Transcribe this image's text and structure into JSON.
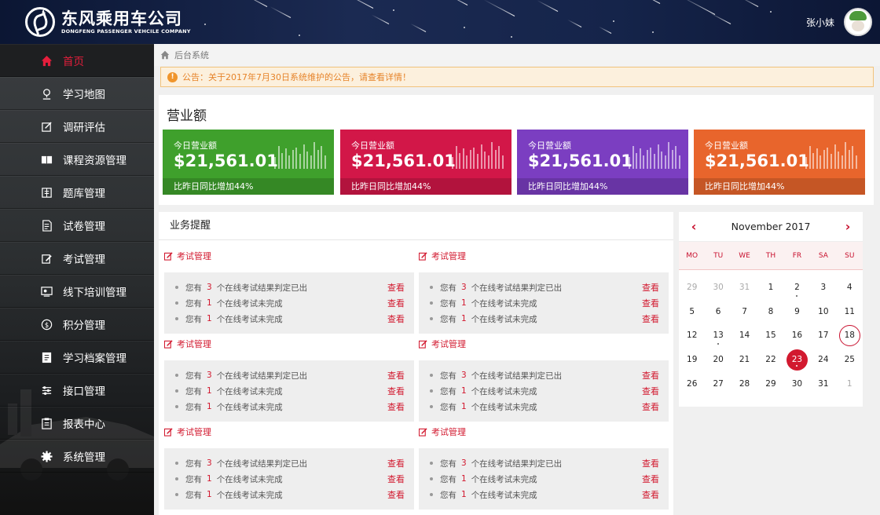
{
  "header": {
    "logo_cn": "东风乘用车公司",
    "logo_en": "DONGFENG PASSENGER VEHCILE COMPANY",
    "user_name": "张小妹"
  },
  "sidebar": {
    "items": [
      {
        "label": "首页",
        "icon": "home-icon",
        "active": true
      },
      {
        "label": "学习地图",
        "icon": "map-pin-icon"
      },
      {
        "label": "调研评估",
        "icon": "survey-edit-icon"
      },
      {
        "label": "课程资源管理",
        "icon": "book-icon"
      },
      {
        "label": "题库管理",
        "icon": "question-bank-icon"
      },
      {
        "label": "试卷管理",
        "icon": "paper-icon"
      },
      {
        "label": "考试管理",
        "icon": "exam-edit-icon"
      },
      {
        "label": "线下培训管理",
        "icon": "training-icon"
      },
      {
        "label": "积分管理",
        "icon": "coin-icon"
      },
      {
        "label": "学习档案管理",
        "icon": "archive-icon"
      },
      {
        "label": "接口管理",
        "icon": "sliders-icon"
      },
      {
        "label": "报表中心",
        "icon": "clipboard-icon"
      },
      {
        "label": "系统管理",
        "icon": "gear-icon"
      }
    ]
  },
  "breadcrumb": "后台系统",
  "notice": "公告：关于2017年7月30日系统维护的公告，请查看详情！",
  "revenue": {
    "title": "营业额",
    "cards": [
      {
        "label": "今日营业额",
        "amount": "$21,561.01",
        "footer": "比昨日同比增加44%",
        "color": "#3fa02c"
      },
      {
        "label": "今日营业额",
        "amount": "$21,561.01",
        "footer": "比昨日同比增加44%",
        "color": "#d21748"
      },
      {
        "label": "今日营业额",
        "amount": "$21,561.01",
        "footer": "比昨日同比增加44%",
        "color": "#7b3ec1"
      },
      {
        "label": "今日营业额",
        "amount": "$21,561.01",
        "footer": "比昨日同比增加44%",
        "color": "#e8652c"
      }
    ],
    "sparkline": [
      0.45,
      0.85,
      0.6,
      0.75,
      0.5,
      0.7,
      0.8,
      0.55,
      0.9,
      0.65,
      0.5,
      1.0,
      0.7,
      0.85,
      0.5
    ]
  },
  "business": {
    "title": "业务提醒",
    "groups": [
      {
        "title": "考试管理",
        "rows": [
          {
            "pre": "您有",
            "n": "3",
            "post": "个在线考试结果判定已出",
            "action": "查看"
          },
          {
            "pre": "您有",
            "n": "1",
            "post": "个在线考试未完成",
            "action": "查看"
          },
          {
            "pre": "您有",
            "n": "1",
            "post": "个在线考试未完成",
            "action": "查看"
          }
        ]
      },
      {
        "title": "考试管理",
        "rows": [
          {
            "pre": "您有",
            "n": "3",
            "post": "个在线考试结果判定已出",
            "action": "查看"
          },
          {
            "pre": "您有",
            "n": "1",
            "post": "个在线考试未完成",
            "action": "查看"
          },
          {
            "pre": "您有",
            "n": "1",
            "post": "个在线考试未完成",
            "action": "查看"
          }
        ]
      },
      {
        "title": "考试管理",
        "rows": [
          {
            "pre": "您有",
            "n": "3",
            "post": "个在线考试结果判定已出",
            "action": "查看"
          },
          {
            "pre": "您有",
            "n": "1",
            "post": "个在线考试未完成",
            "action": "查看"
          },
          {
            "pre": "您有",
            "n": "1",
            "post": "个在线考试未完成",
            "action": "查看"
          }
        ]
      },
      {
        "title": "考试管理",
        "rows": [
          {
            "pre": "您有",
            "n": "3",
            "post": "个在线考试结果判定已出",
            "action": "查看"
          },
          {
            "pre": "您有",
            "n": "1",
            "post": "个在线考试未完成",
            "action": "查看"
          },
          {
            "pre": "您有",
            "n": "1",
            "post": "个在线考试未完成",
            "action": "查看"
          }
        ]
      },
      {
        "title": "考试管理",
        "rows": [
          {
            "pre": "您有",
            "n": "3",
            "post": "个在线考试结果判定已出",
            "action": "查看"
          },
          {
            "pre": "您有",
            "n": "1",
            "post": "个在线考试未完成",
            "action": "查看"
          },
          {
            "pre": "您有",
            "n": "1",
            "post": "个在线考试未完成",
            "action": "查看"
          }
        ]
      },
      {
        "title": "考试管理",
        "rows": [
          {
            "pre": "您有",
            "n": "3",
            "post": "个在线考试结果判定已出",
            "action": "查看"
          },
          {
            "pre": "您有",
            "n": "1",
            "post": "个在线考试未完成",
            "action": "查看"
          },
          {
            "pre": "您有",
            "n": "1",
            "post": "个在线考试未完成",
            "action": "查看"
          }
        ]
      }
    ]
  },
  "calendar": {
    "month": "November 2017",
    "prev": "‹",
    "next": "›",
    "weekdays": [
      "MO",
      "TU",
      "WE",
      "TH",
      "FR",
      "SA",
      "SU"
    ],
    "days": [
      {
        "d": "29",
        "muted": true
      },
      {
        "d": "30",
        "muted": true
      },
      {
        "d": "31",
        "muted": true
      },
      {
        "d": "1"
      },
      {
        "d": "2",
        "dot": true
      },
      {
        "d": "3"
      },
      {
        "d": "4"
      },
      {
        "d": "5"
      },
      {
        "d": "6"
      },
      {
        "d": "7"
      },
      {
        "d": "8"
      },
      {
        "d": "9"
      },
      {
        "d": "10"
      },
      {
        "d": "11"
      },
      {
        "d": "12"
      },
      {
        "d": "13",
        "dot": true
      },
      {
        "d": "14"
      },
      {
        "d": "15"
      },
      {
        "d": "16"
      },
      {
        "d": "17"
      },
      {
        "d": "18",
        "today": true
      },
      {
        "d": "19"
      },
      {
        "d": "20"
      },
      {
        "d": "21"
      },
      {
        "d": "22"
      },
      {
        "d": "23",
        "selected": true,
        "dot": true
      },
      {
        "d": "24"
      },
      {
        "d": "25"
      },
      {
        "d": "26"
      },
      {
        "d": "27"
      },
      {
        "d": "28"
      },
      {
        "d": "29"
      },
      {
        "d": "30"
      },
      {
        "d": "31"
      },
      {
        "d": "1",
        "muted": true
      }
    ]
  }
}
